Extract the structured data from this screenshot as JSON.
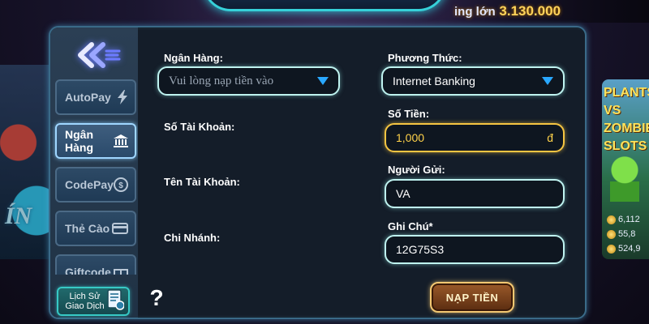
{
  "background": {
    "jackpot_prefix": "ing lớn",
    "jackpot_value": "3.130.000",
    "left_art_text": "ÍN",
    "right_game_title": "PLANTS VS ZOMBIES SLOTS",
    "stats": [
      "6,112",
      "55,8",
      "524,9"
    ]
  },
  "sidebar": {
    "items": [
      {
        "label": "AutoPay",
        "icon": "lightning-icon",
        "active": false
      },
      {
        "label": "Ngân Hàng",
        "icon": "bank-icon",
        "active": true
      },
      {
        "label": "CodePay",
        "icon": "coin-icon",
        "active": false
      },
      {
        "label": "Thẻ Cào",
        "icon": "card-icon",
        "active": false
      },
      {
        "label": "Giftcode",
        "icon": "gift-icon",
        "active": false
      }
    ],
    "history_line1": "Lịch Sử",
    "history_line2": "Giao Dịch"
  },
  "form": {
    "bank_label": "Ngân Hàng:",
    "bank_placeholder": "Vui lòng nạp tiền vào",
    "account_number_label": "Số Tài Khoản:",
    "account_name_label": "Tên Tài Khoản:",
    "branch_label": "Chi Nhánh:",
    "method_label": "Phương Thức:",
    "method_value": "Internet Banking",
    "amount_label": "Số Tiền:",
    "amount_value": "1,000",
    "currency": "đ",
    "sender_label": "Người Gửi:",
    "sender_value": "VA",
    "note_label": "Ghi Chú*",
    "note_value": "12G75S3"
  },
  "actions": {
    "help": "?",
    "submit": "NẠP TIỀN"
  },
  "colors": {
    "field_border": "#bff3f0",
    "amount_border": "#f5c542",
    "dropdown_caret": "#29a8ff",
    "submit_bg": "#7a4320"
  }
}
